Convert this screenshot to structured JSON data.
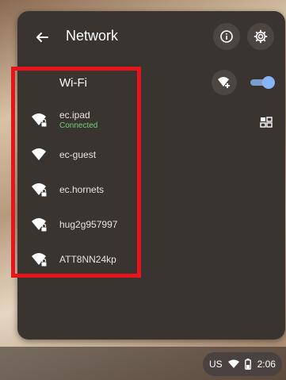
{
  "header": {
    "title": "Network",
    "back_icon": "arrow-left-icon",
    "info_icon": "info-icon",
    "settings_icon": "gear-icon"
  },
  "wifi": {
    "title": "Wi-Fi",
    "add_icon": "add-wifi-icon",
    "enabled": true
  },
  "networks": [
    {
      "name": "ec.ipad",
      "status": "Connected",
      "secured": true,
      "has_details": true
    },
    {
      "name": "ec-guest",
      "status": "",
      "secured": false,
      "has_details": false
    },
    {
      "name": "ec.hornets",
      "status": "",
      "secured": true,
      "has_details": false
    },
    {
      "name": "hug2g957997",
      "status": "",
      "secured": true,
      "has_details": false
    },
    {
      "name": "ATT8NN24kp",
      "status": "",
      "secured": true,
      "has_details": false
    }
  ],
  "tray": {
    "locale": "US",
    "time": "2:06"
  },
  "colors": {
    "panel": "#3a3431",
    "connected": "#6fcf72",
    "toggle_on": "#8ab4f8",
    "highlight": "#e8141c"
  }
}
